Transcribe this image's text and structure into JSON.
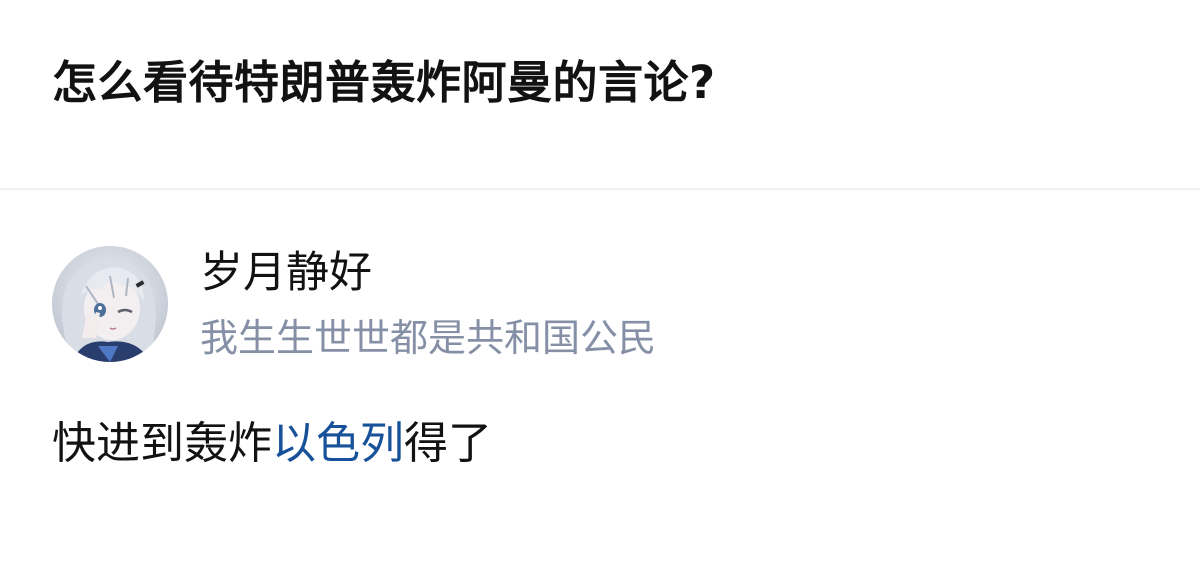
{
  "question": {
    "title": "怎么看待特朗普轰炸阿曼的言论?"
  },
  "author": {
    "name": "岁月静好",
    "headline": "我生生世世都是共和国公民",
    "avatar_icon": "anime-avatar-icon"
  },
  "answer": {
    "text_before": "快进到轰炸",
    "link_text": "以色列",
    "text_after": "得了"
  },
  "colors": {
    "title": "#121212",
    "headline": "#8590a6",
    "link": "#175199",
    "divider": "#f2f2f4"
  }
}
